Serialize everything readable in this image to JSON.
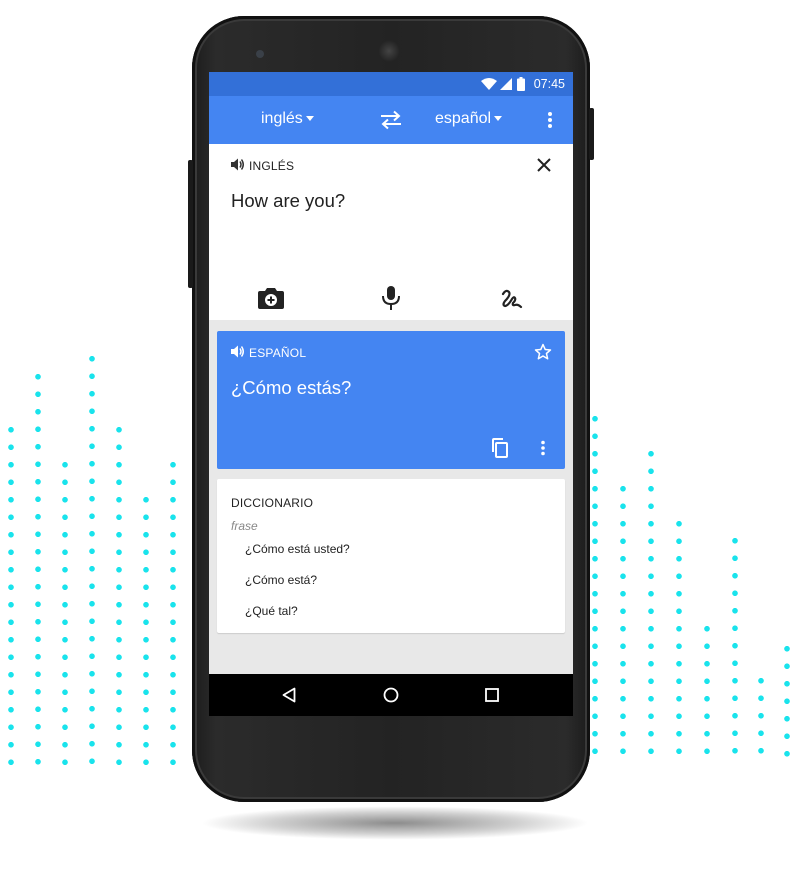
{
  "colors": {
    "accent": "#4485f2",
    "status_bar": "#3370d8",
    "dots": "#19e3ec"
  },
  "status_bar": {
    "time": "07:45",
    "icons": [
      "wifi-icon",
      "signal-icon",
      "battery-icon"
    ]
  },
  "app_bar": {
    "source_lang": "inglés",
    "target_lang": "español",
    "swap_icon": "swap-arrows-icon",
    "menu_icon": "more-vert-icon"
  },
  "source_card": {
    "lang_label": "INGLÉS",
    "text": "How are you?",
    "tools": [
      "camera-icon",
      "microphone-icon",
      "handwriting-icon"
    ]
  },
  "translation_card": {
    "lang_label": "ESPAÑOL",
    "text": "¿Cómo estás?"
  },
  "dictionary": {
    "title": "DICCIONARIO",
    "part_of_speech": "frase",
    "entries": [
      "¿Cómo está usted?",
      "¿Cómo está?",
      "¿Qué tal?"
    ]
  },
  "nav_bar": [
    "back-icon",
    "home-icon",
    "recents-icon"
  ]
}
